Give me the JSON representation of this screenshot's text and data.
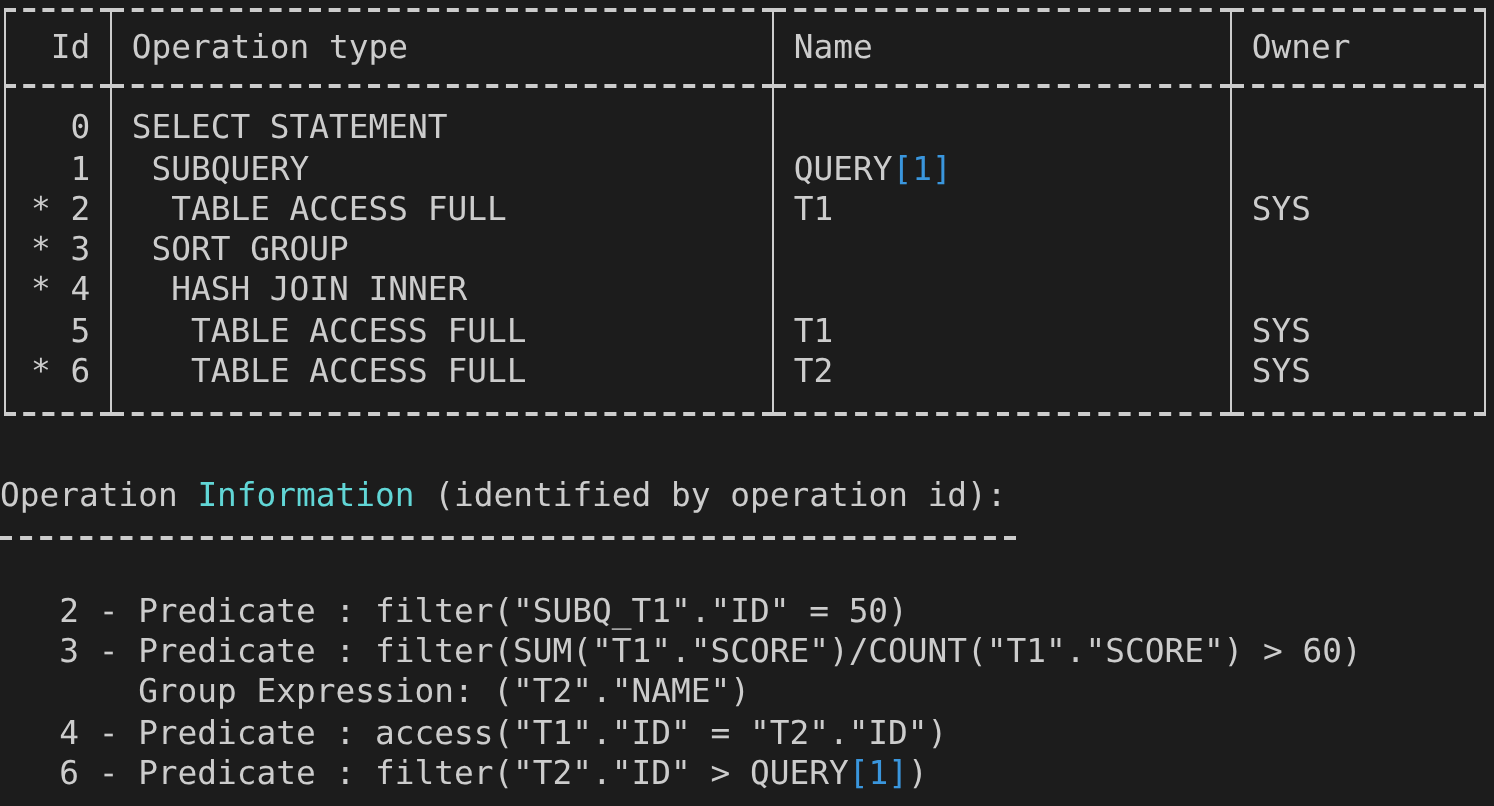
{
  "plan_table": {
    "columns": [
      "Id",
      "Operation type",
      "Name",
      "Owner"
    ],
    "operations": [
      {
        "id": "0",
        "type": "SELECT STATEMENT",
        "children": [
          {
            "id": "1",
            "type": "SUBQUERY",
            "name": "QUERY",
            "name_ref": "[1]",
            "children": [
              {
                "id": "2",
                "flag": "*",
                "type": "TABLE ACCESS FULL",
                "name": "T1",
                "owner": "SYS"
              }
            ]
          },
          {
            "id": "3",
            "flag": "*",
            "type": "SORT GROUP",
            "children": [
              {
                "id": "4",
                "flag": "*",
                "type": "HASH JOIN INNER",
                "children": [
                  {
                    "id": "5",
                    "type": "TABLE ACCESS FULL",
                    "name": "T1",
                    "owner": "SYS"
                  },
                  {
                    "id": "6",
                    "flag": "*",
                    "type": "TABLE ACCESS FULL",
                    "name": "T2",
                    "owner": "SYS"
                  }
                ]
              }
            ]
          }
        ]
      }
    ]
  },
  "operation_info": {
    "heading": {
      "before": "Operation ",
      "highlight": "Information",
      "after": " (identified by operation id):"
    },
    "lines": [
      {
        "kind": "predicate",
        "text": "2 - Predicate : filter(\"SUBQ_T1\".\"ID\" = 50)"
      },
      {
        "kind": "predicate",
        "text": "3 - Predicate : filter(SUM(\"T1\".\"SCORE\")/COUNT(\"T1\".\"SCORE\") > 60)"
      },
      {
        "kind": "continuation",
        "text": "Group Expression: (\"T2\".\"NAME\")"
      },
      {
        "kind": "predicate",
        "text": "4 - Predicate : access(\"T1\".\"ID\" = \"T2\".\"ID\")"
      },
      {
        "kind": "predicate",
        "text": "6 - Predicate : filter(\"T2\".\"ID\" > QUERY",
        "ref": "[1]",
        "tail": ")"
      }
    ]
  }
}
